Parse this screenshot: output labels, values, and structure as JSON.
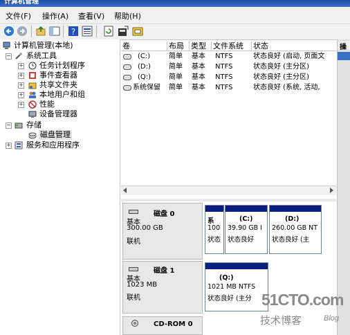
{
  "window": {
    "title": "计算机管理"
  },
  "menu": [
    "文件(F)",
    "操作(A)",
    "查看(V)",
    "帮助(H)"
  ],
  "toolbar_icons": [
    "back-icon",
    "forward-icon",
    "up-icon",
    "show-hide-tree-icon",
    "help-icon",
    "properties-icon",
    "refresh-icon",
    "export-icon",
    "settings-icon"
  ],
  "tree": {
    "root": "计算机管理(本地)",
    "system_tools": "系统工具",
    "task_scheduler": "任务计划程序",
    "event_viewer": "事件查看器",
    "shared_folders": "共享文件夹",
    "local_users": "本地用户和组",
    "performance": "性能",
    "device_manager": "设备管理器",
    "storage": "存储",
    "disk_management": "磁盘管理",
    "services": "服务和应用程序"
  },
  "volume_table": {
    "headers": [
      "卷",
      "布局",
      "类型",
      "文件系统",
      "状态"
    ],
    "rows": [
      [
        "(C:)",
        "简单",
        "基本",
        "NTFS",
        "状态良好 (启动, 页面文"
      ],
      [
        "(D:)",
        "简单",
        "基本",
        "NTFS",
        "状态良好 (主分区)"
      ],
      [
        "(Q:)",
        "简单",
        "基本",
        "NTFS",
        "状态良好 (主分区)"
      ],
      [
        "系统保留",
        "简单",
        "基本",
        "NTFS",
        "状态良好 (系统, 活动,"
      ]
    ]
  },
  "disks": [
    {
      "name": "磁盘 0",
      "type": "基本",
      "size": "300.00 GB",
      "status": "联机",
      "volumes": [
        {
          "label": "系",
          "size": "100",
          "status": "状态"
        },
        {
          "label": "(C:)",
          "size": "39.90 GB I",
          "status": "状态良好"
        },
        {
          "label": "(D:)",
          "size": "260.00 GB NT",
          "status": "状态良好 (主"
        }
      ]
    },
    {
      "name": "磁盘 1",
      "type": "基本",
      "size": "1023 MB",
      "status": "联机",
      "volumes": [
        {
          "label": "(Q:)",
          "size": "1021 MB NTFS",
          "status": "状态良好 (主分"
        }
      ]
    },
    {
      "name": "CD-ROM 0"
    }
  ],
  "right_panel": {
    "header": "操"
  },
  "watermark": {
    "logo": "51CTO.com",
    "sub": "技术博客",
    "blog": "Blog"
  }
}
